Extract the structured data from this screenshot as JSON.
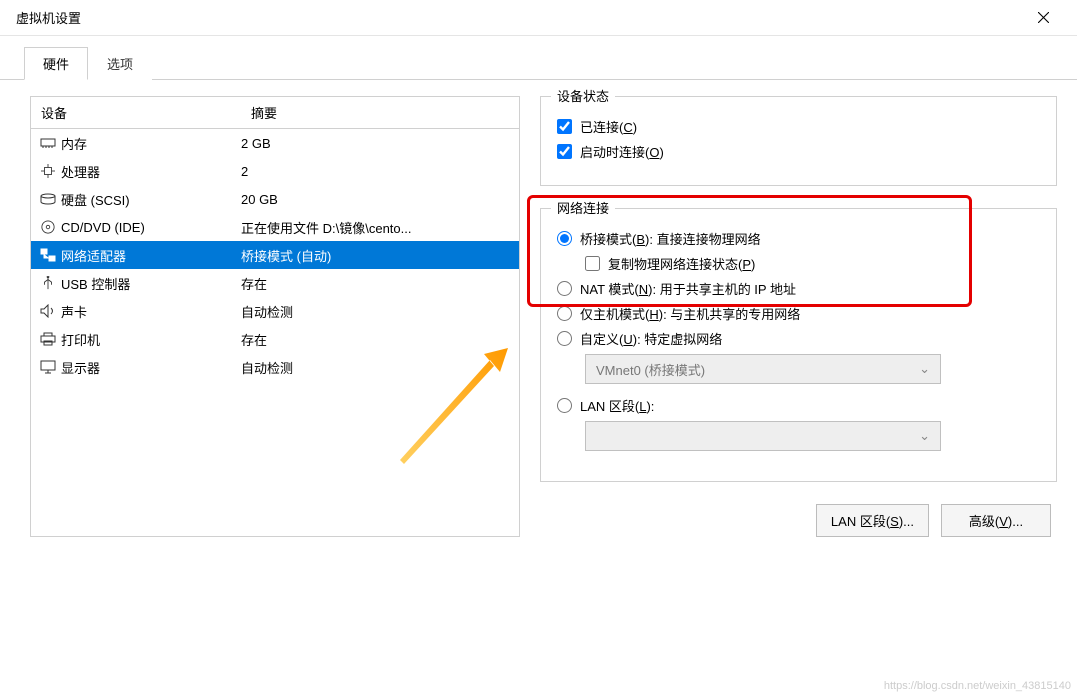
{
  "window": {
    "title": "虚拟机设置"
  },
  "tabs": {
    "hardware": "硬件",
    "options": "选项"
  },
  "device_table": {
    "col_device": "设备",
    "col_summary": "摘要",
    "rows": [
      {
        "name": "内存",
        "summary": "2 GB",
        "icon": "memory"
      },
      {
        "name": "处理器",
        "summary": "2",
        "icon": "cpu"
      },
      {
        "name": "硬盘 (SCSI)",
        "summary": "20 GB",
        "icon": "disk"
      },
      {
        "name": "CD/DVD (IDE)",
        "summary": "正在使用文件 D:\\镜像\\cento...",
        "icon": "disc"
      },
      {
        "name": "网络适配器",
        "summary": "桥接模式 (自动)",
        "icon": "network",
        "selected": true
      },
      {
        "name": "USB 控制器",
        "summary": "存在",
        "icon": "usb"
      },
      {
        "name": "声卡",
        "summary": "自动检测",
        "icon": "sound"
      },
      {
        "name": "打印机",
        "summary": "存在",
        "icon": "printer"
      },
      {
        "name": "显示器",
        "summary": "自动检测",
        "icon": "display"
      }
    ]
  },
  "status_group": {
    "legend": "设备状态",
    "connected_prefix": "已连接(",
    "connected_key": "C",
    "connected_suffix": ")",
    "connect_on_prefix": "启动时连接(",
    "connect_on_key": "O",
    "connect_on_suffix": ")"
  },
  "network_group": {
    "legend": "网络连接",
    "bridge_prefix": "桥接模式(",
    "bridge_key": "B",
    "bridge_suffix": "): 直接连接物理网络",
    "replicate_prefix": "复制物理网络连接状态(",
    "replicate_key": "P",
    "replicate_suffix": ")",
    "nat_prefix": "NAT 模式(",
    "nat_key": "N",
    "nat_suffix": "): 用于共享主机的 IP 地址",
    "host_prefix": "仅主机模式(",
    "host_key": "H",
    "host_suffix": "): 与主机共享的专用网络",
    "custom_prefix": "自定义(",
    "custom_key": "U",
    "custom_suffix": "): 特定虚拟网络",
    "vmnet_dropdown": "VMnet0 (桥接模式)",
    "lan_prefix": "LAN 区段(",
    "lan_key": "L",
    "lan_suffix": "):",
    "lan_dropdown": ""
  },
  "buttons": {
    "lan_prefix": "LAN 区段(",
    "lan_key": "S",
    "lan_suffix": ")...",
    "adv_prefix": "高级(",
    "adv_key": "V",
    "adv_suffix": ")..."
  },
  "watermark": "https://blog.csdn.net/weixin_43815140"
}
